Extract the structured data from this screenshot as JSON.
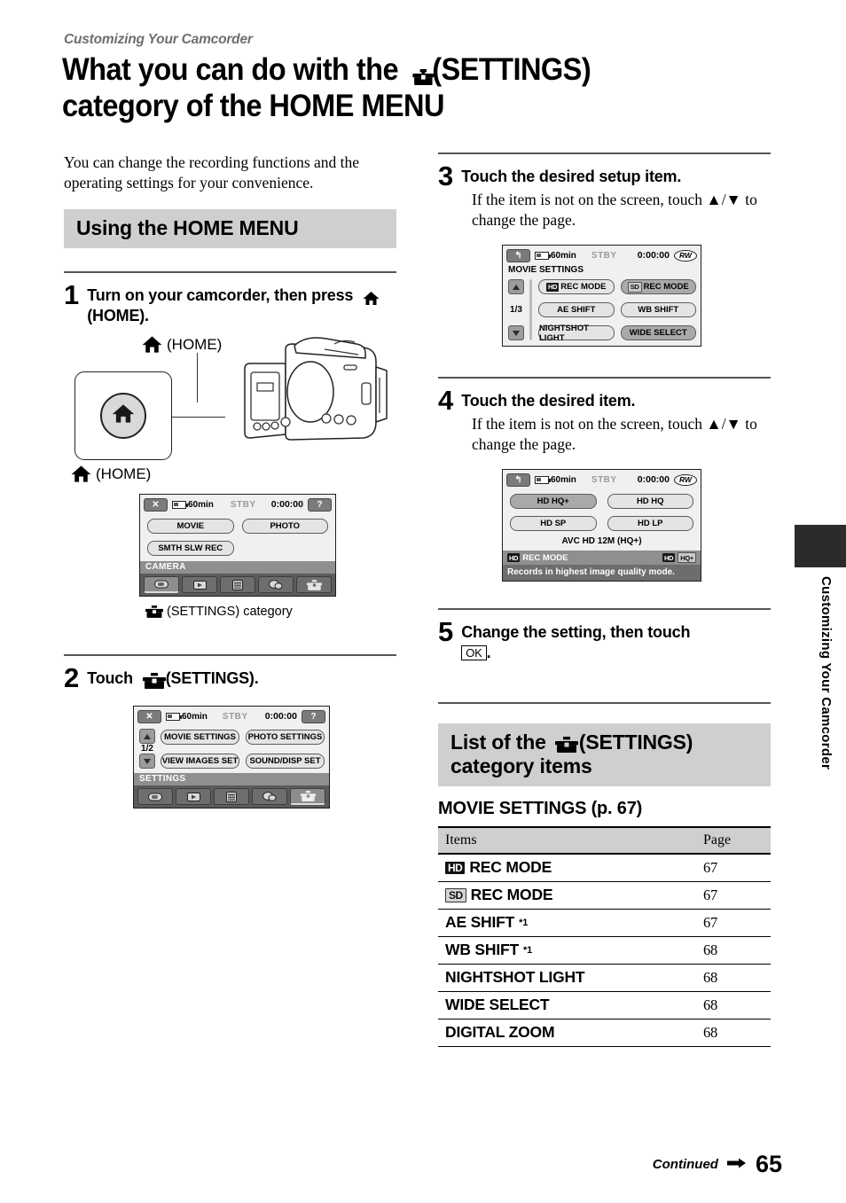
{
  "header": {
    "running_head": "Customizing Your Camcorder",
    "title_line1_before": "What you can do with the ",
    "title_line1_after": "(SETTINGS)",
    "title_line2": "category of the HOME MENU"
  },
  "intro": "You can change the recording functions and the operating settings for your convenience.",
  "section_using": {
    "band_label": "Using the HOME MENU"
  },
  "steps": {
    "s1": {
      "num": "1",
      "head_before": "Turn on your camcorder, then press ",
      "head_after": "(HOME)."
    },
    "s2": {
      "num": "2",
      "head_before": "Touch ",
      "head_after": "(SETTINGS)."
    },
    "s3": {
      "num": "3",
      "head": "Touch the desired setup item.",
      "body": "If the item is not on the screen, touch ▲/▼ to change the page."
    },
    "s4": {
      "num": "4",
      "head": "Touch the desired item.",
      "body": "If the item is not on the screen, touch ▲/▼ to change the page."
    },
    "s5": {
      "num": "5",
      "head_before": "Change the setting, then touch ",
      "ok_label": "OK",
      "head_after": "."
    }
  },
  "illustration": {
    "home_label_top": "(HOME)",
    "home_label_bottom": "(HOME)"
  },
  "caption_settings_category": "(SETTINGS) category",
  "screen_home": {
    "close_label": "✕",
    "battery": "60min",
    "status": "STBY",
    "timecode": "0:00:00",
    "help_label": "?",
    "buttons": [
      "MOVIE",
      "PHOTO",
      "SMTH SLW REC"
    ],
    "category_label": "CAMERA",
    "category_icons": [
      "camera-icon",
      "playback-icon",
      "manage-media-icon",
      "others-icon",
      "settings-icon"
    ],
    "active_index": 0
  },
  "screen_settings": {
    "close_label": "✕",
    "battery": "60min",
    "status": "STBY",
    "timecode": "0:00:00",
    "help_label": "?",
    "page_indicator": "1/2",
    "buttons": [
      "MOVIE SETTINGS",
      "PHOTO SETTINGS",
      "VIEW IMAGES SET",
      "SOUND/DISP SET"
    ],
    "category_label": "SETTINGS",
    "active_index": 4
  },
  "screen_movie_settings": {
    "back_label": "↰",
    "battery": "60min",
    "status": "STBY",
    "timecode": "0:00:00",
    "disc_label": "RW",
    "title": "MOVIE SETTINGS",
    "page_indicator": "1/3",
    "items": [
      {
        "badge": "HD",
        "label": "REC MODE",
        "selected": false
      },
      {
        "badge": "SD",
        "label": "REC MODE",
        "selected": true
      },
      {
        "badge": "",
        "label": "AE SHIFT",
        "selected": false
      },
      {
        "badge": "",
        "label": "WB SHIFT",
        "selected": false
      },
      {
        "badge": "",
        "label": "NIGHTSHOT LIGHT",
        "selected": false
      },
      {
        "badge": "",
        "label": "WIDE SELECT",
        "selected": true
      }
    ]
  },
  "screen_rec_mode": {
    "back_label": "↰",
    "battery": "60min",
    "status": "STBY",
    "timecode": "0:00:00",
    "disc_label": "RW",
    "options": [
      {
        "label": "HD HQ+",
        "selected": true
      },
      {
        "label": "HD HQ",
        "selected": false
      },
      {
        "label": "HD SP",
        "selected": false
      },
      {
        "label": "HD LP",
        "selected": false
      }
    ],
    "detail": "AVC HD 12M (HQ+)",
    "footer_badge": "HD",
    "footer_title": "REC MODE",
    "footer_right_1": "HD",
    "footer_right_2": "HQ+",
    "description": "Records in highest image quality mode."
  },
  "section_list": {
    "band_before": "List of the ",
    "band_after": "(SETTINGS)",
    "band_line2": "category items"
  },
  "table": {
    "title": "MOVIE SETTINGS (p. 67)",
    "col_items": "Items",
    "col_page": "Page",
    "rows": [
      {
        "badge": "HD",
        "badge_style": "dark",
        "label": "REC MODE",
        "note": "",
        "page": "67"
      },
      {
        "badge": "SD",
        "badge_style": "light",
        "label": "REC MODE",
        "note": "",
        "page": "67"
      },
      {
        "badge": "",
        "badge_style": "",
        "label": "AE SHIFT",
        "note": "*1",
        "page": "67"
      },
      {
        "badge": "",
        "badge_style": "",
        "label": "WB SHIFT",
        "note": "*1",
        "page": "68"
      },
      {
        "badge": "",
        "badge_style": "",
        "label": "NIGHTSHOT LIGHT",
        "note": "",
        "page": "68"
      },
      {
        "badge": "",
        "badge_style": "",
        "label": "WIDE SELECT",
        "note": "",
        "page": "68"
      },
      {
        "badge": "",
        "badge_style": "",
        "label": "DIGITAL ZOOM",
        "note": "",
        "page": "68"
      }
    ]
  },
  "side_tab_text": "Customizing Your Camcorder",
  "footer": {
    "continued": "Continued",
    "page_number": "65"
  }
}
